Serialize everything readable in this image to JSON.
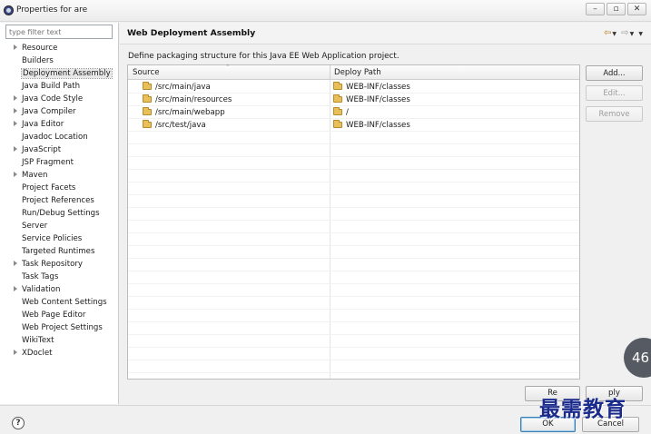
{
  "window": {
    "title": "Properties for are",
    "buttons": {
      "minimize": "–",
      "restore": "▫",
      "close": "✕"
    }
  },
  "filter": {
    "placeholder": "type filter text"
  },
  "tree": {
    "items": [
      {
        "label": "Resource",
        "expandable": true
      },
      {
        "label": "Builders",
        "expandable": false
      },
      {
        "label": "Deployment Assembly",
        "expandable": false,
        "selected": true
      },
      {
        "label": "Java Build Path",
        "expandable": false
      },
      {
        "label": "Java Code Style",
        "expandable": true
      },
      {
        "label": "Java Compiler",
        "expandable": true
      },
      {
        "label": "Java Editor",
        "expandable": true
      },
      {
        "label": "Javadoc Location",
        "expandable": false
      },
      {
        "label": "JavaScript",
        "expandable": true
      },
      {
        "label": "JSP Fragment",
        "expandable": false
      },
      {
        "label": "Maven",
        "expandable": true
      },
      {
        "label": "Project Facets",
        "expandable": false
      },
      {
        "label": "Project References",
        "expandable": false
      },
      {
        "label": "Run/Debug Settings",
        "expandable": false
      },
      {
        "label": "Server",
        "expandable": false
      },
      {
        "label": "Service Policies",
        "expandable": false
      },
      {
        "label": "Targeted Runtimes",
        "expandable": false
      },
      {
        "label": "Task Repository",
        "expandable": true
      },
      {
        "label": "Task Tags",
        "expandable": false
      },
      {
        "label": "Validation",
        "expandable": true
      },
      {
        "label": "Web Content Settings",
        "expandable": false
      },
      {
        "label": "Web Page Editor",
        "expandable": false
      },
      {
        "label": "Web Project Settings",
        "expandable": false
      },
      {
        "label": "WikiText",
        "expandable": false
      },
      {
        "label": "XDoclet",
        "expandable": true
      }
    ]
  },
  "main": {
    "title": "Web Deployment Assembly",
    "description": "Define packaging structure for this Java EE Web Application project.",
    "nav": {
      "back": "⇦",
      "back_dd": "▼",
      "forward": "⇨",
      "forward_dd": "▼",
      "menu": "▼"
    },
    "table": {
      "columns": [
        "Source",
        "Deploy Path"
      ],
      "sort_indicator": "ˆ",
      "rows": [
        {
          "source": "/src/main/java",
          "deploy": "WEB-INF/classes"
        },
        {
          "source": "/src/main/resources",
          "deploy": "WEB-INF/classes"
        },
        {
          "source": "/src/main/webapp",
          "deploy": "/"
        },
        {
          "source": "/src/test/java",
          "deploy": "WEB-INF/classes"
        }
      ]
    },
    "buttons": {
      "add": "Add...",
      "edit": "Edit...",
      "remove": "Remove"
    }
  },
  "footer": {
    "help": "?",
    "restore_defaults": "Re",
    "apply": "ply",
    "ok": "OK",
    "cancel": "Cancel"
  },
  "overlay": {
    "badge": "46",
    "watermark": "最需教育"
  }
}
